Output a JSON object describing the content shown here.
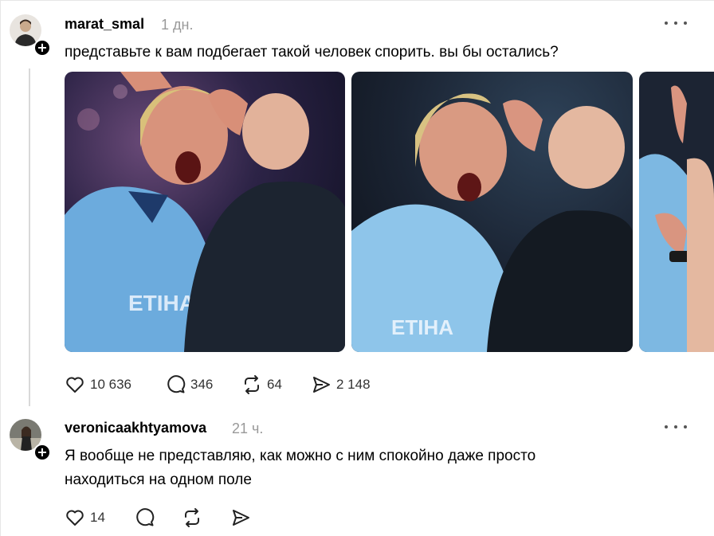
{
  "post": {
    "username": "marat_smal",
    "time": "1 дн.",
    "text": "представьте к вам подбегает такой человек спорить. вы бы остались?",
    "likes": "10 636",
    "comments": "346",
    "reposts": "64",
    "shares": "2 148"
  },
  "reply": {
    "username": "veronicaakhtyamova",
    "time": "21 ч.",
    "text_line1": "Я вообще не представляю, как можно с ним спокойно даже просто",
    "text_line2": "находиться на одном поле",
    "likes": "14"
  },
  "icons": {
    "like": "heart-icon",
    "comment": "comment-bubble-icon",
    "repost": "repost-arrows-icon",
    "share": "send-arrow-icon",
    "more": "more-dots-icon",
    "follow": "plus-icon"
  },
  "colors": {
    "jersey": "#6cabdd",
    "referee": "#1c2430",
    "background": "#ffffff",
    "muted": "#999999"
  }
}
